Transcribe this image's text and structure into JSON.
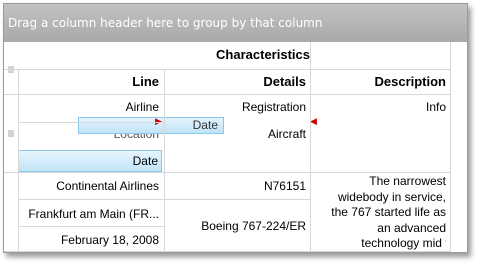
{
  "group_panel": {
    "hint": "Drag a column header here to group by that column"
  },
  "header": {
    "band_title": "Characteristics",
    "columns": {
      "line": "Line",
      "details": "Details",
      "description": "Description"
    }
  },
  "field_chooser": {
    "line_field": "Airline",
    "location_field": "Location",
    "date_field": "Date",
    "registration_field": "Registration",
    "aircraft_field": "Aircraft",
    "info_field": "Info",
    "drag_ghost": "Date"
  },
  "record": {
    "airline": "Continental Airlines",
    "location": "Frankfurt am Main (FR...",
    "date": "February 18, 2008",
    "registration": "N76151",
    "aircraft": "Boeing 767-224/ER",
    "description_lines": [
      "The narrowest",
      "widebody in service,",
      "the 767 started life as",
      "an advanced",
      "technology mid to la"
    ]
  },
  "colors": {
    "drag_highlight": "#c2e5f8",
    "drop_indicator": "#d00000",
    "group_panel_bg": "#a9a9a9"
  }
}
